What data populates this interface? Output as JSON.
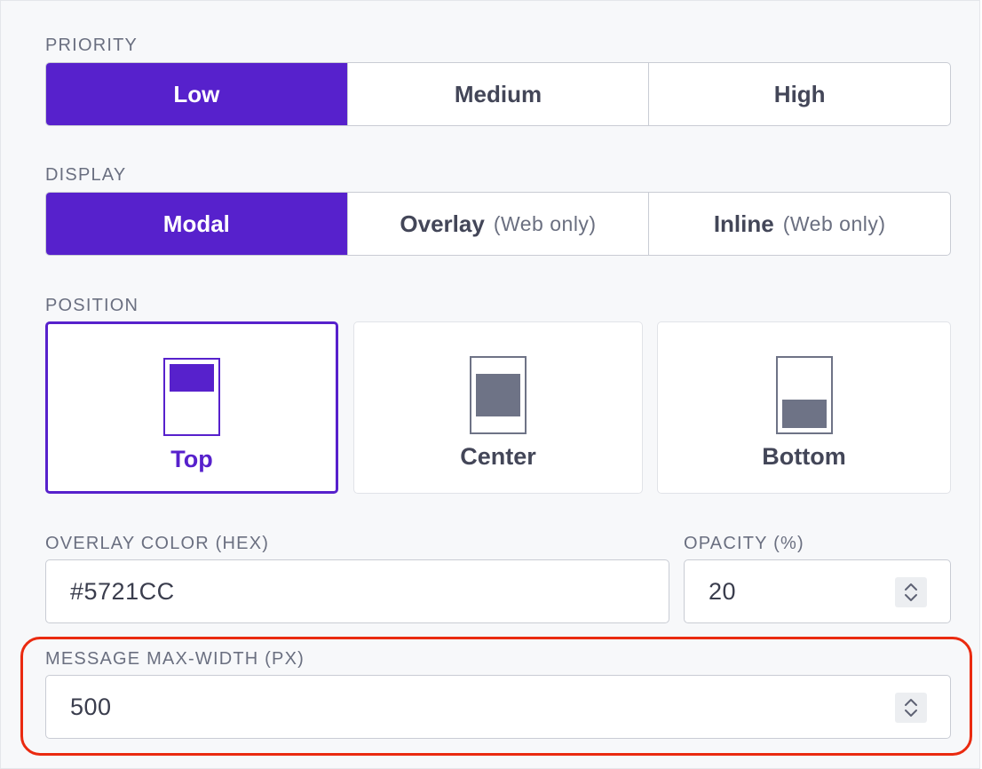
{
  "priority": {
    "label": "PRIORITY",
    "options": [
      {
        "label": "Low",
        "selected": true
      },
      {
        "label": "Medium",
        "selected": false
      },
      {
        "label": "High",
        "selected": false
      }
    ]
  },
  "display": {
    "label": "DISPLAY",
    "options": [
      {
        "label": "Modal",
        "note": "",
        "selected": true
      },
      {
        "label": "Overlay",
        "note": "(Web only)",
        "selected": false
      },
      {
        "label": "Inline",
        "note": "(Web only)",
        "selected": false
      }
    ]
  },
  "position": {
    "label": "POSITION",
    "options": [
      {
        "label": "Top",
        "icon": "position-top-icon",
        "selected": true
      },
      {
        "label": "Center",
        "icon": "position-center-icon",
        "selected": false
      },
      {
        "label": "Bottom",
        "icon": "position-bottom-icon",
        "selected": false
      }
    ]
  },
  "overlay_color": {
    "label": "OVERLAY COLOR (HEX)",
    "value": "#5721CC"
  },
  "opacity": {
    "label": "OPACITY (%)",
    "value": "20"
  },
  "max_width": {
    "label": "MESSAGE MAX-WIDTH (PX)",
    "value": "500"
  },
  "colors": {
    "accent": "#5721CC",
    "highlight_outline": "#EA2A10",
    "inactive_icon": "#6E7386"
  }
}
